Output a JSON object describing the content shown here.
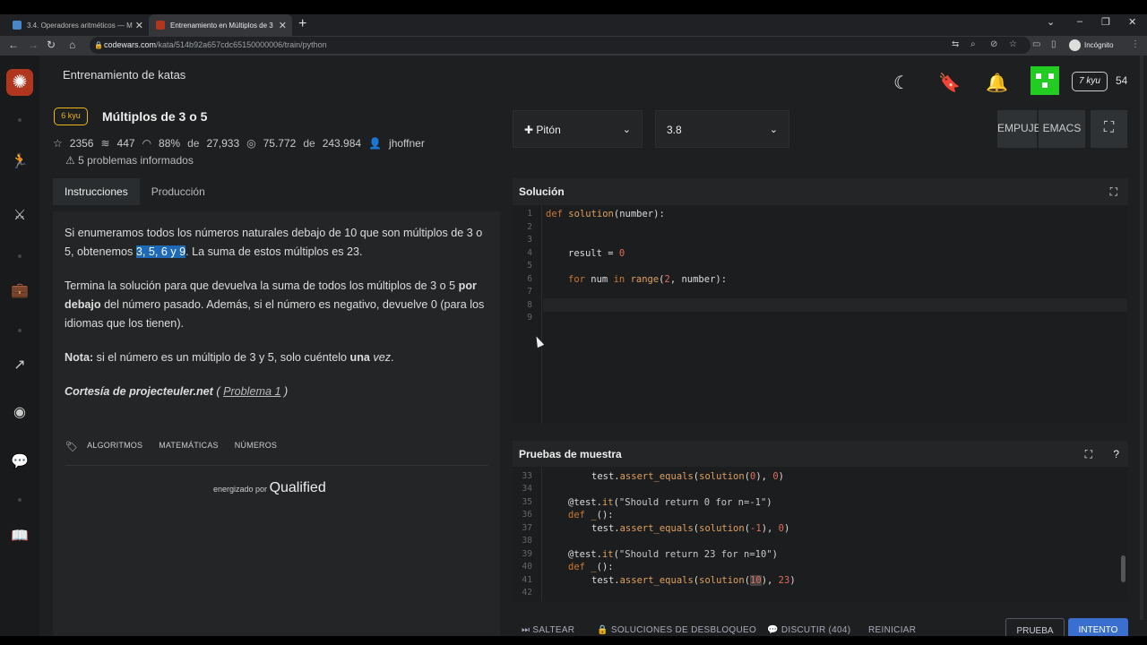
{
  "browser": {
    "tabs": [
      {
        "label": "3.4. Operadores aritméticos — M",
        "active": false
      },
      {
        "label": "Entrenamiento en Múltiplos de 3",
        "active": true
      }
    ],
    "url_domain": "codewars.com",
    "url_path": "/kata/514b92a657cdc65150000006/train/python",
    "incognito_label": "Incógnito"
  },
  "header": {
    "title": "Entrenamiento de katas",
    "rank": "7 kyu",
    "honor": "54"
  },
  "kata": {
    "kyu": "6 kyu",
    "title": "Múltiplos de 3 o 5",
    "stars": "2356",
    "collections": "447",
    "satisfaction": "88%",
    "satisfaction_of": "de",
    "votes": "27,933",
    "completed": "75.772",
    "completed_of": "de",
    "attempts": "243.984",
    "author": "jhoffner",
    "reported": "5 problemas informados"
  },
  "tabs": [
    "Instrucciones",
    "Producción"
  ],
  "description": {
    "p1_a": "Si enumeramos todos los números naturales debajo de 10 que son múltiplos de 3 o 5, obtenemos ",
    "p1_hl": "3, 5, 6 y 9",
    "p1_b": ". La suma de estos múltiplos es 23.",
    "p2_a": "Termina la solución para que devuelva la suma de todos los múltiplos de 3 o 5 ",
    "p2_bold": "por debajo",
    "p2_b": " del número pasado. Además, si el número es negativo, devuelve 0 (para los idiomas que los tienen).",
    "p3_bold": "Nota:",
    "p3_a": " si el número es un múltiplo de 3 y 5, solo cuéntelo ",
    "p3_bold2": "una",
    "p3_ital": "vez",
    "p3_end": ".",
    "p4_a": "Cortesía de projecteuler.net",
    "p4_b": " ( ",
    "p4_link": "Problema 1",
    "p4_c": " )"
  },
  "tags": [
    "ALGORITMOS",
    "MATEMÁTICAS",
    "NÚMEROS"
  ],
  "powered": {
    "label": "energizado por",
    "brand": "Qualified"
  },
  "editor": {
    "language": "Pitón",
    "version": "3.8",
    "modes": [
      "EMPUJE",
      "EMACS"
    ],
    "solution_title": "Solución",
    "tests_title": "Pruebas de muestra",
    "solution_lines": [
      "1",
      "2",
      "3",
      "4",
      "5",
      "6",
      "7",
      "8",
      "9"
    ],
    "test_lines": [
      "33",
      "34",
      "35",
      "36",
      "37",
      "38",
      "39",
      "40",
      "41",
      "42"
    ]
  },
  "footer": {
    "skip": "SALTEAR",
    "unlock": "SOLUCIONES DE DESBLOQUEO",
    "discuss": "DISCUTIR (404)",
    "reset": "REINICIAR",
    "test": "PRUEBA",
    "attempt": "INTENTO"
  }
}
